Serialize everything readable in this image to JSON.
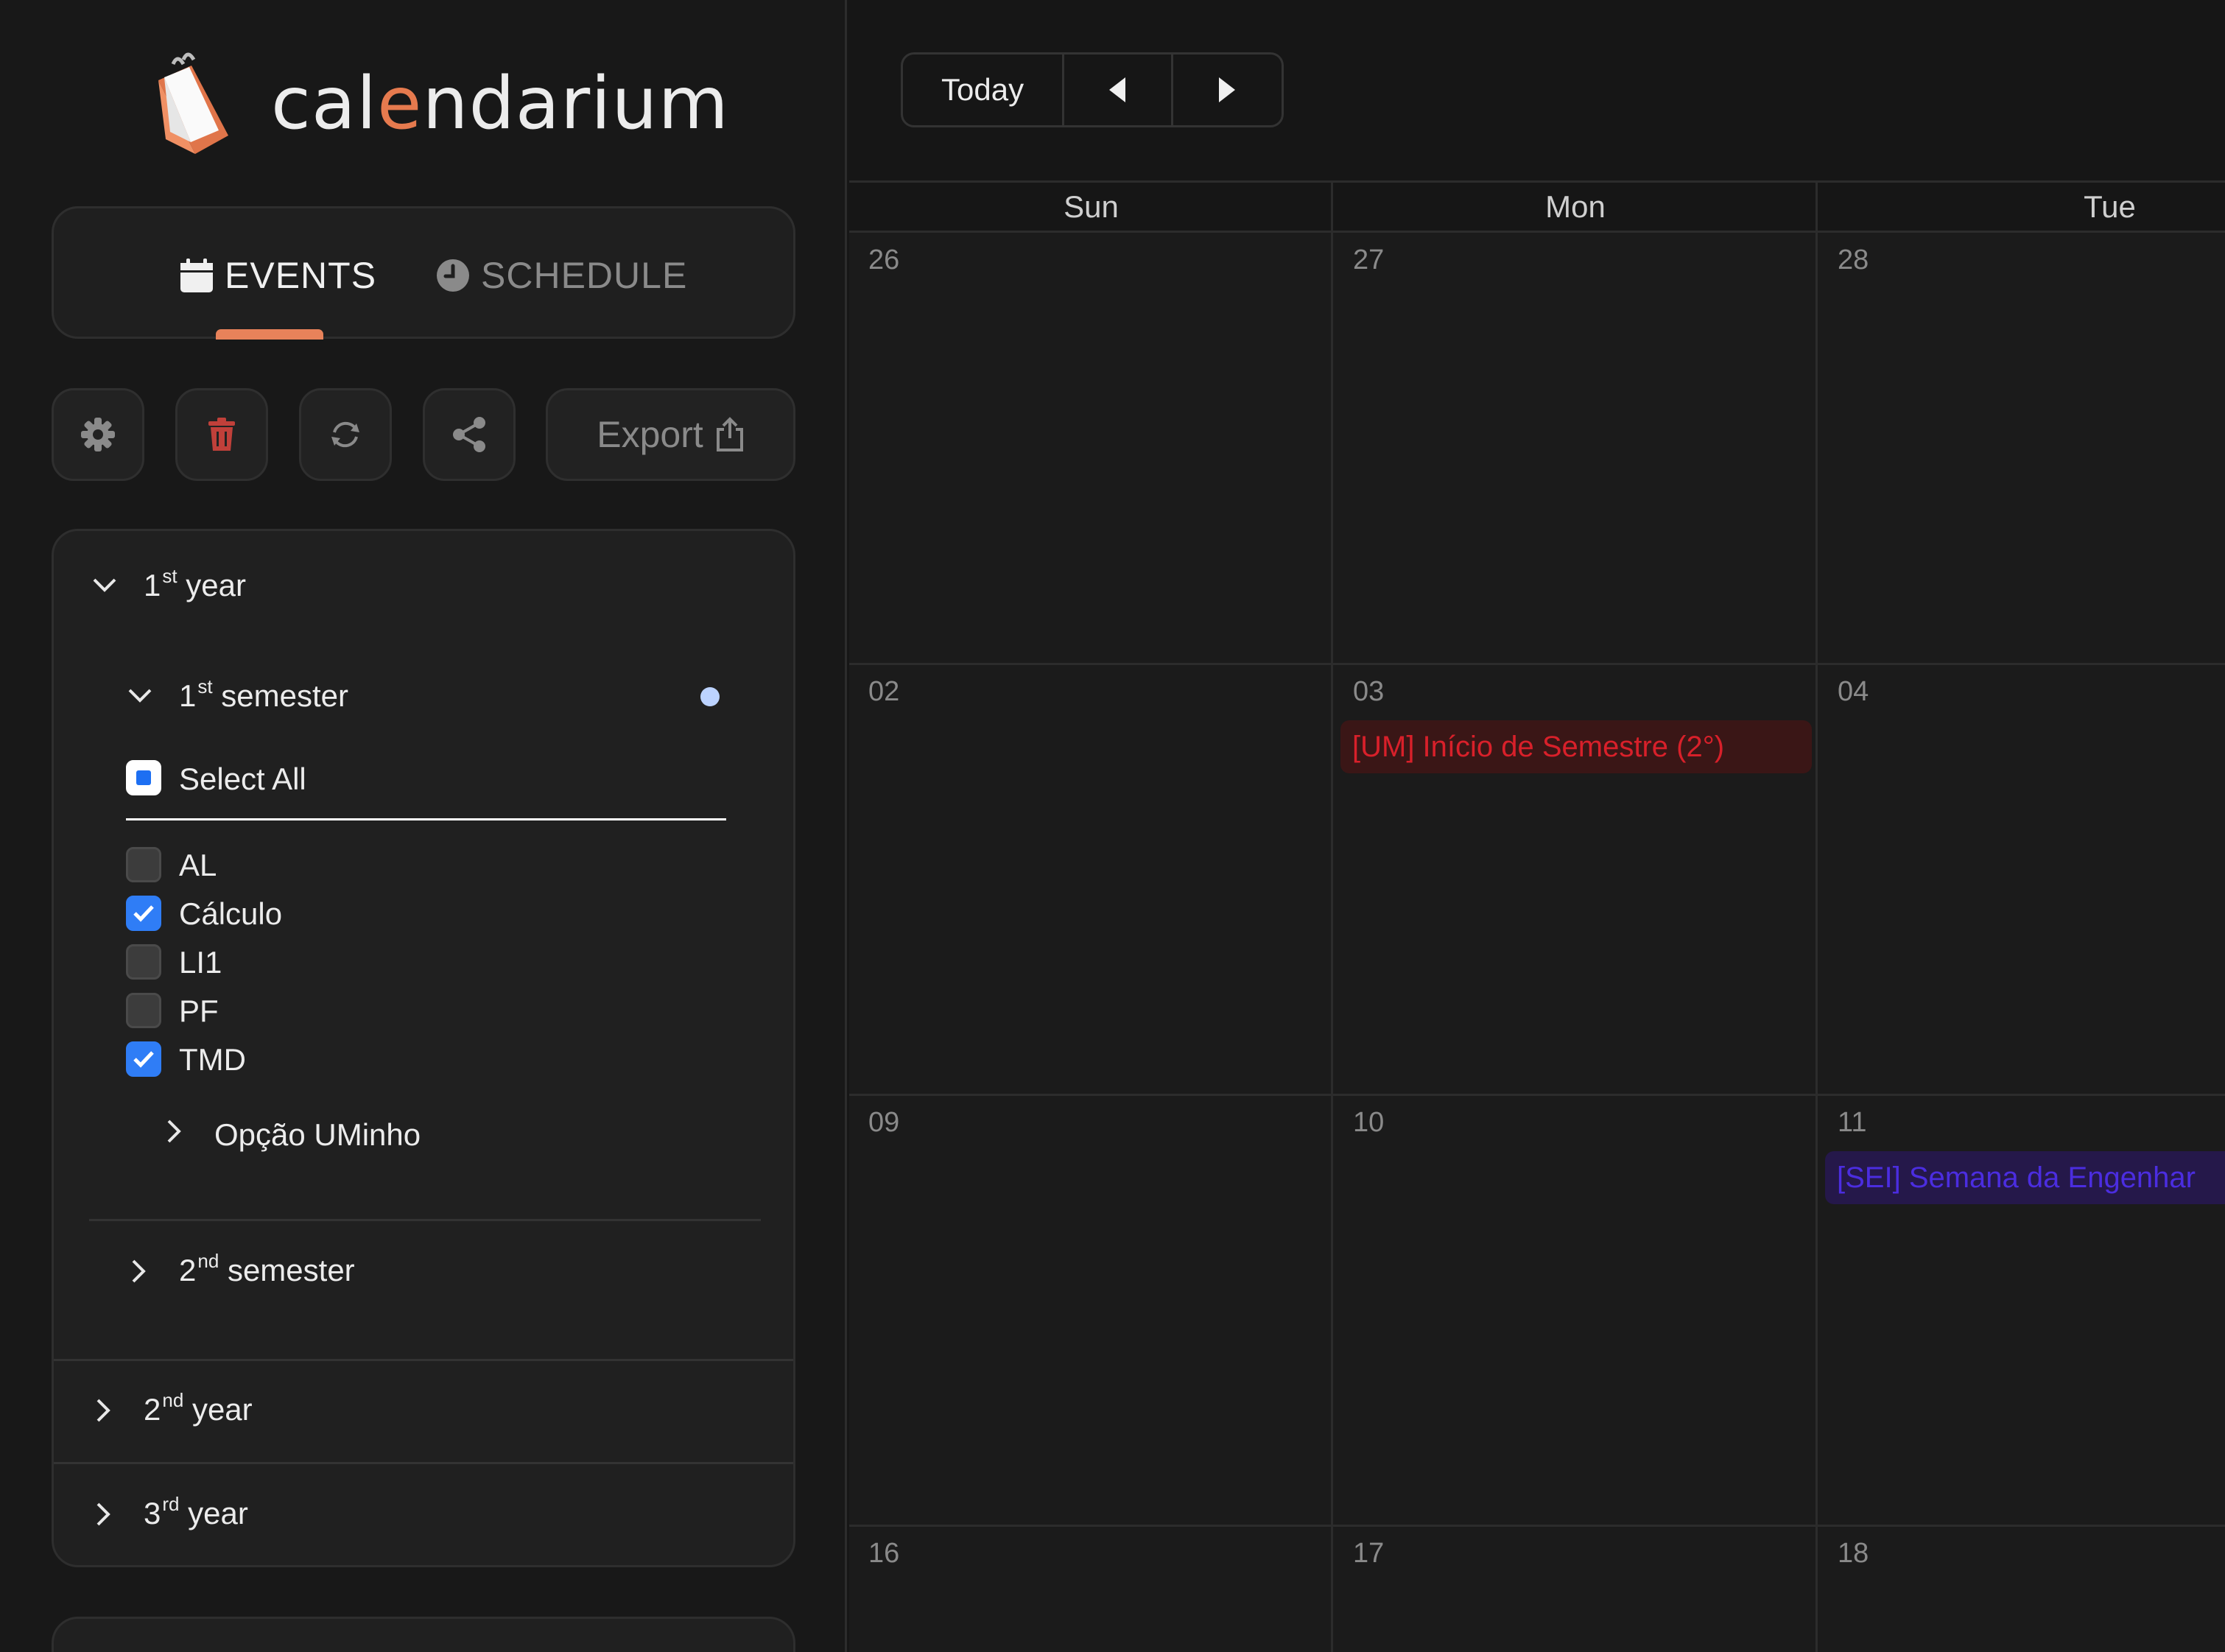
{
  "app": {
    "logo_prefix": "cal",
    "logo_accent": "e",
    "logo_suffix": "ndarium",
    "accent_color": "#e67a4e"
  },
  "tabs": [
    {
      "label": "EVENTS",
      "icon": "calendar-icon",
      "active": true
    },
    {
      "label": "SCHEDULE",
      "icon": "clock-icon",
      "active": false
    }
  ],
  "toolbar": {
    "settings_icon": "gear-icon",
    "delete_icon": "trash-icon",
    "refresh_icon": "refresh-icon",
    "share_icon": "share-icon",
    "export_label": "Export",
    "export_icon": "upload-icon"
  },
  "filters": {
    "year1": {
      "num": "1",
      "sup": "st",
      "word": "year",
      "expanded": true
    },
    "semester1": {
      "num": "1",
      "sup": "st",
      "word": "semester",
      "expanded": true
    },
    "select_all_label": "Select All",
    "subjects": [
      {
        "label": "AL",
        "checked": false
      },
      {
        "label": "Cálculo",
        "checked": true
      },
      {
        "label": "LI1",
        "checked": false
      },
      {
        "label": "PF",
        "checked": false
      },
      {
        "label": "TMD",
        "checked": true
      }
    ],
    "option_group": "Opção UMinho",
    "semester2": {
      "num": "2",
      "sup": "nd",
      "word": "semester"
    },
    "year2": {
      "num": "2",
      "sup": "nd",
      "word": "year"
    },
    "year3": {
      "num": "3",
      "sup": "rd",
      "word": "year"
    }
  },
  "calendar": {
    "today_label": "Today",
    "weekdays": [
      "Sun",
      "Mon",
      "Tue"
    ],
    "weeks": [
      [
        "26",
        "27",
        "28"
      ],
      [
        "02",
        "03",
        "04"
      ],
      [
        "09",
        "10",
        "11"
      ],
      [
        "16",
        "17",
        "18"
      ]
    ],
    "events": [
      {
        "title": "[UM] Início de Semestre (2°)",
        "color": "#d8202a"
      },
      {
        "title": "[SEI] Semana da Engenhar",
        "color": "#4b2de0"
      }
    ]
  }
}
